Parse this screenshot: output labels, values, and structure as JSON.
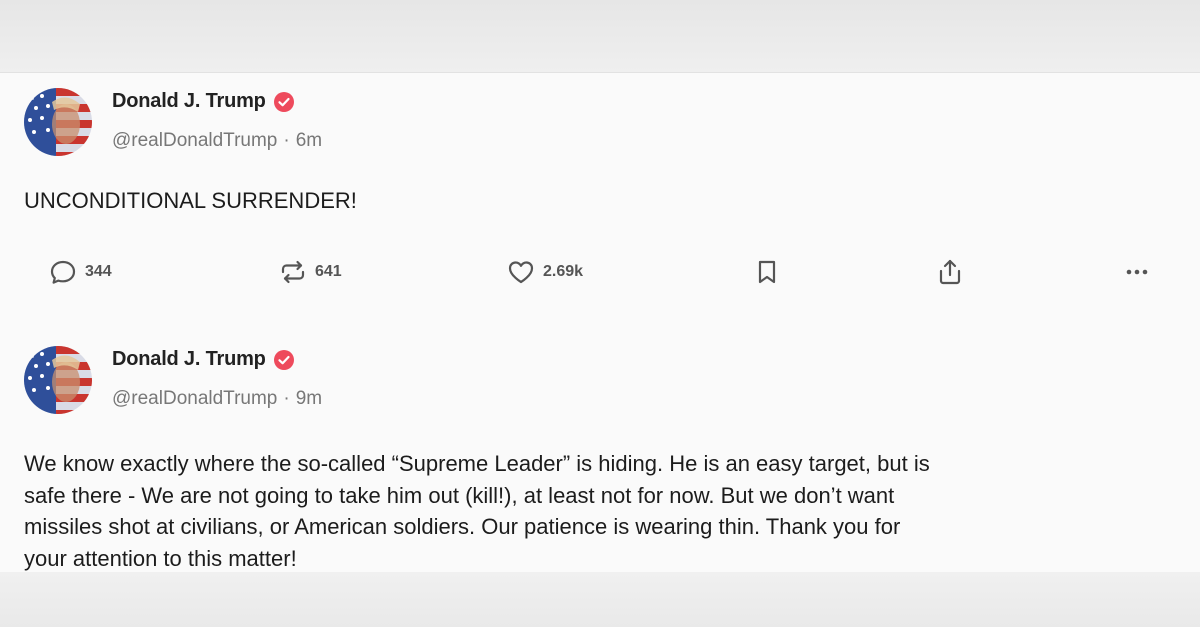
{
  "posts": [
    {
      "author": {
        "display_name": "Donald J. Trump",
        "handle": "@realDonaldTrump",
        "verified": true,
        "avatar": "american-flag-portrait"
      },
      "separator": "·",
      "time_ago": "6m",
      "text": "UNCONDITIONAL SURRENDER!",
      "actions": {
        "reply_count": "344",
        "repost_count": "641",
        "like_count": "2.69k",
        "icons": [
          "reply-icon",
          "repost-icon",
          "heart-icon",
          "bookmark-icon",
          "share-icon",
          "more-icon"
        ]
      }
    },
    {
      "author": {
        "display_name": "Donald J. Trump",
        "handle": "@realDonaldTrump",
        "verified": true,
        "avatar": "american-flag-portrait"
      },
      "separator": "·",
      "time_ago": "9m",
      "text_lines": [
        "We know exactly where the so-called “Supreme Leader” is hiding. He is an easy target, but is",
        "safe there - We are not going to take him out (kill!), at least not for now. But we don’t want",
        "missiles shot at civilians, or American soldiers. Our patience is wearing thin. Thank you for",
        "your attention to this matter!"
      ]
    }
  ],
  "colors": {
    "verified_badge": "#ee4a5c",
    "icon_gray": "#555555",
    "handle_gray": "#777777",
    "text": "#1c1c1c",
    "background": "#fafafa"
  }
}
